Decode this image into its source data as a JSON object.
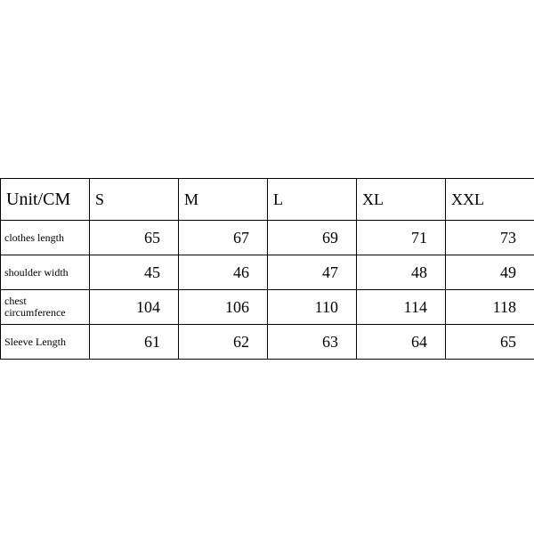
{
  "chart_data": {
    "type": "table",
    "title": "Unit/CM",
    "columns": [
      "S",
      "M",
      "L",
      "XL",
      "XXL"
    ],
    "rows": [
      {
        "label": "clothes length",
        "values": [
          65,
          67,
          69,
          71,
          73
        ]
      },
      {
        "label": "shoulder width",
        "values": [
          45,
          46,
          47,
          48,
          49
        ]
      },
      {
        "label": "chest circumference",
        "values": [
          104,
          106,
          110,
          114,
          118
        ]
      },
      {
        "label": "Sleeve Length",
        "values": [
          61,
          62,
          63,
          64,
          65
        ]
      }
    ]
  }
}
